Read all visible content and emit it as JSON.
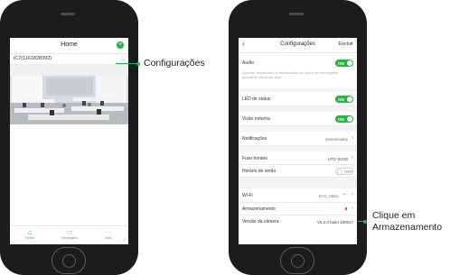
{
  "home_screen": {
    "title": "Home",
    "add_icon": "plus-icon",
    "device_name": "iC7(1161828392)",
    "settings_icon": "gear-icon",
    "tabs": [
      {
        "label": "Home",
        "icon": "home-icon"
      },
      {
        "label": "Mensagens",
        "icon": "message-icon"
      },
      {
        "label": "Mais",
        "icon": "more-icon"
      }
    ]
  },
  "callout_configuracoes": "Configurações",
  "settings_screen": {
    "back_icon": "chevron-left-icon",
    "title": "Configurações",
    "delete_label": "Excluir",
    "audio": {
      "label": "Áudio",
      "toggle": "ON"
    },
    "audio_description": "Quando desativado, a visualização ao vivo e as mensagens gravadas não terão som.",
    "led_status": {
      "label": "LED de status",
      "toggle": "ON"
    },
    "night_vision": {
      "label": "Visão noturna",
      "toggle": "ON"
    },
    "notifications": {
      "label": "Notificações",
      "value": "Desativadas"
    },
    "timezone": {
      "label": "Fuso horário",
      "value": "UTC-03:00"
    },
    "daylight_saving": {
      "label": "Horário de verão",
      "toggle": "OFF"
    },
    "wifi": {
      "label": "Wi-Fi",
      "value": "EAS_Mitac",
      "icon": "wifi-icon"
    },
    "storage": {
      "label": "Armazenamento"
    },
    "camera_version": {
      "label": "Versão da câmera",
      "value": "V5.2.0 build 180517"
    }
  },
  "callout_armazenamento": {
    "line1": "Clique em",
    "line2": "Armazenamento"
  },
  "colors": {
    "accent": "#1fb83a",
    "alert": "#e53935",
    "phone_body": "#1c1c1e"
  }
}
